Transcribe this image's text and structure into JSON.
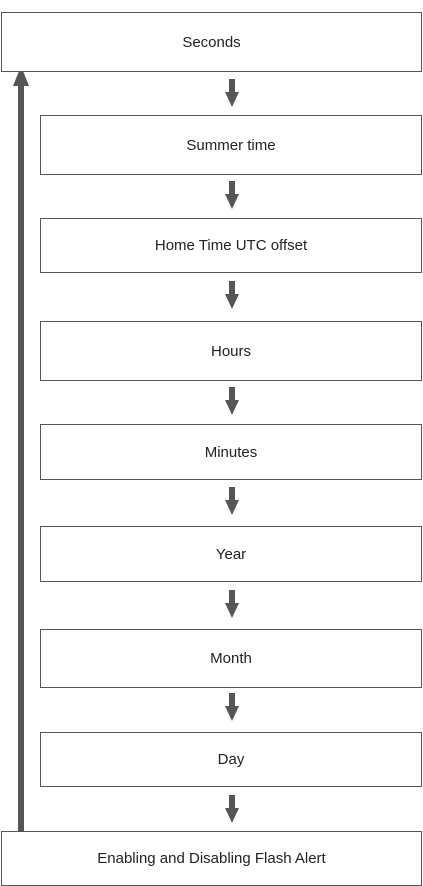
{
  "steps": [
    "Seconds",
    "Summer time",
    "Home Time UTC offset",
    "Hours",
    "Minutes",
    "Year",
    "Month",
    "Day",
    "Enabling and Disabling Flash Alert"
  ],
  "colors": {
    "arrow": "#555555",
    "border": "#555555",
    "text": "#222222"
  }
}
